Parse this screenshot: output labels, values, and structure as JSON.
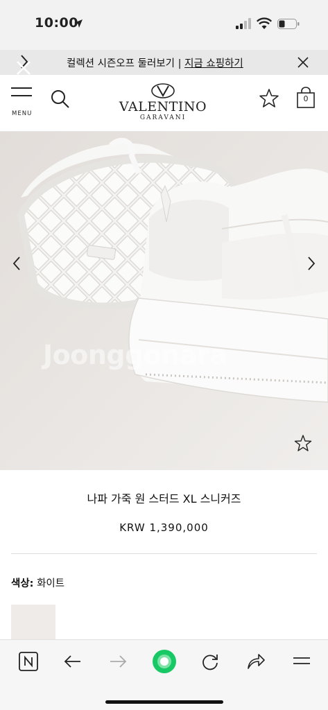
{
  "status_bar": {
    "time": "10:00",
    "icons": [
      "location-arrow-icon",
      "signal-icon",
      "wifi-icon",
      "battery-icon"
    ]
  },
  "promo": {
    "text": "컬렉션 시즌오프 둘러보기 | ",
    "link": "지금 쇼핑하기"
  },
  "header": {
    "menu_label": "MENU",
    "brand_name": "VALENTINO",
    "brand_sub": "GARAVANI",
    "bag_count": "0"
  },
  "product": {
    "watermark": "Joonggonara",
    "name": "나파 가죽 원 스터드 XL 스니커즈",
    "price": "KRW 1,390,000",
    "color_label": "색상:",
    "color_value": " 화이트"
  },
  "toolbar": {
    "icons": [
      "naver-n-icon",
      "back-arrow-icon",
      "forward-arrow-icon",
      "green-dot-icon",
      "reload-icon",
      "share-icon",
      "menu-icon"
    ]
  },
  "colors": {
    "image_bg": "#ece9e6",
    "green_accent": "#17c964",
    "promo_bg": "#e8e8e8"
  }
}
